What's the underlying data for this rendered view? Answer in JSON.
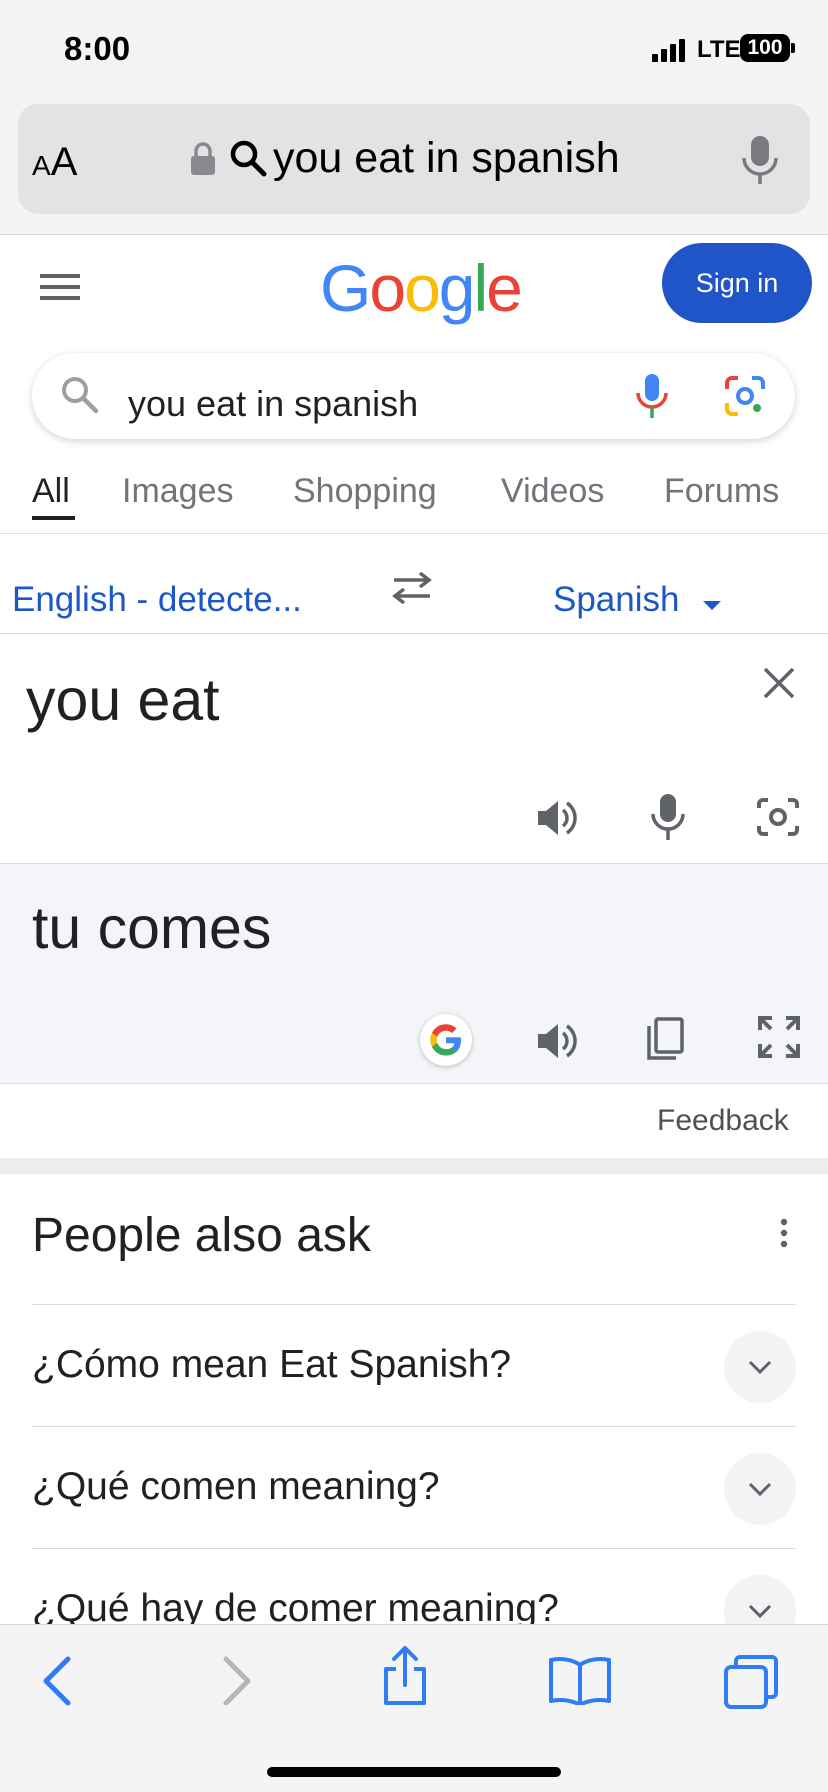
{
  "status_bar": {
    "time": "8:00",
    "network": "LTE",
    "battery": "100"
  },
  "safari": {
    "text_size_label_small": "A",
    "text_size_label_large": "A",
    "address_text": "you eat in spanish"
  },
  "google": {
    "logo_letters": [
      "G",
      "o",
      "o",
      "g",
      "l",
      "e"
    ],
    "logo_colors": [
      "#4285F4",
      "#EA4335",
      "#FBBC05",
      "#4285F4",
      "#34A853",
      "#EA4335"
    ],
    "sign_in_label": "Sign in",
    "search_query": "you eat in spanish",
    "tabs": [
      "All",
      "Images",
      "Shopping",
      "Videos",
      "Forums"
    ]
  },
  "translate": {
    "source_language": "English - detecte...",
    "target_language": "Spanish",
    "source_text": "you eat",
    "translated_text": "tu comes",
    "feedback_label": "Feedback"
  },
  "people_also_ask": {
    "title": "People also ask",
    "questions": [
      "¿Cómo mean Eat Spanish?",
      "¿Qué comen meaning?",
      "¿Qué hay de comer meaning?"
    ]
  },
  "colors": {
    "accent_blue": "#1a58c7",
    "sign_in_bg": "#1f55c9",
    "ios_blue": "#2f7cf6"
  },
  "icons": [
    "lock-icon",
    "search-icon",
    "mic-icon",
    "menu-icon",
    "lens-icon",
    "swap-icon",
    "close-icon",
    "speaker-icon",
    "camera-icon",
    "google-g-icon",
    "copy-icon",
    "fullscreen-icon",
    "more-vert-icon",
    "chevron-down-icon",
    "back-icon",
    "forward-icon",
    "share-icon",
    "bookmarks-icon",
    "tabs-icon"
  ]
}
